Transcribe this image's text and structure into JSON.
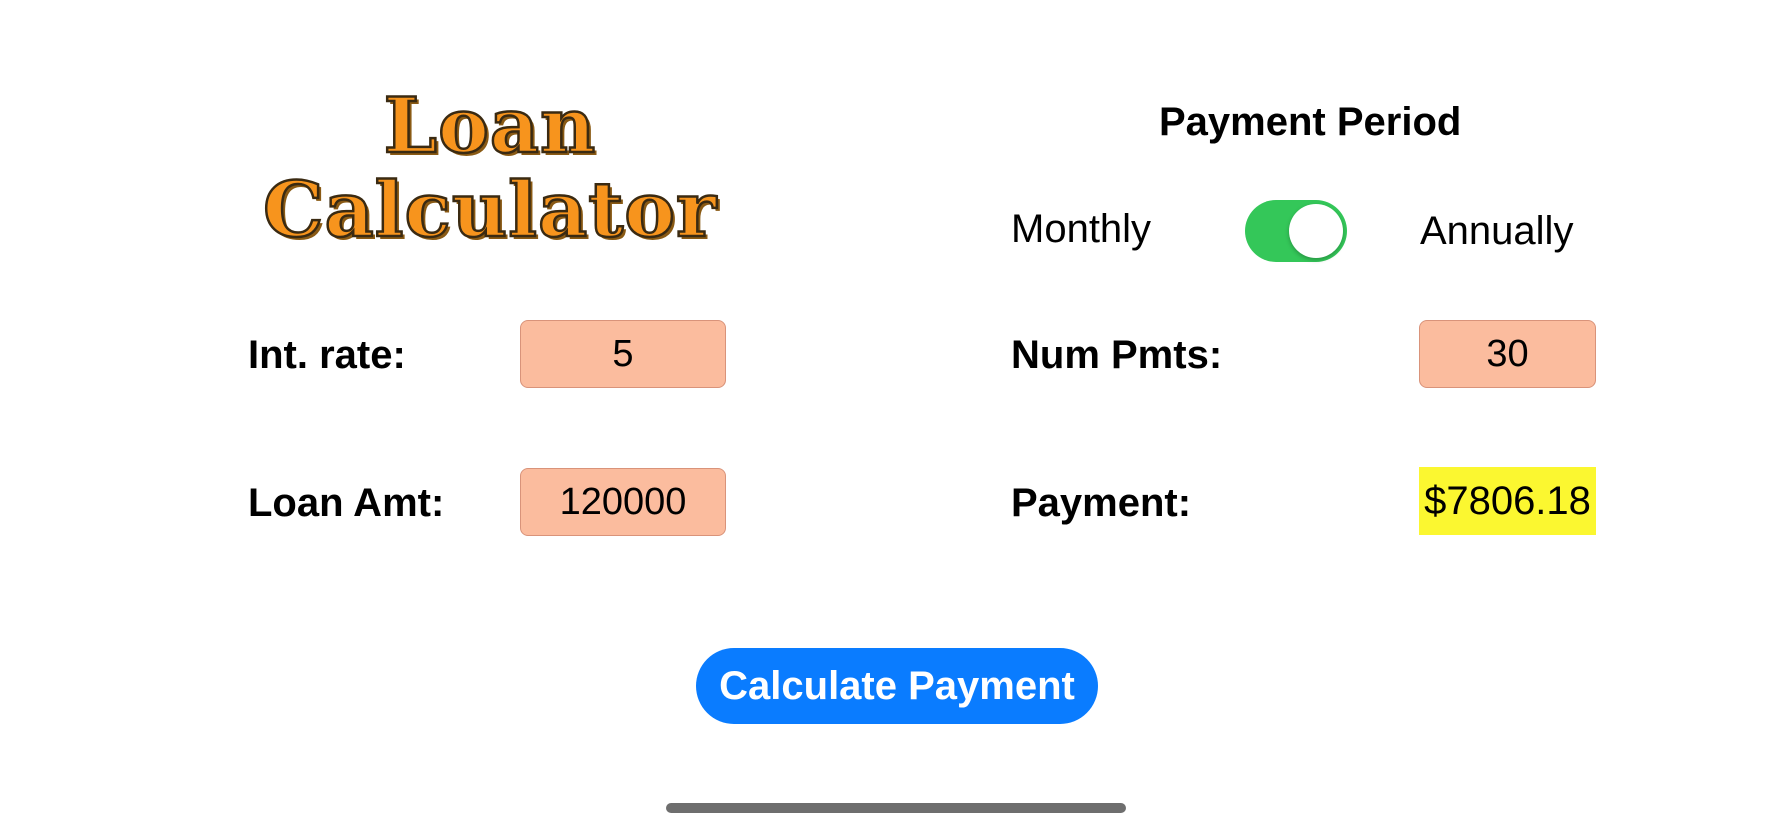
{
  "logo": {
    "line1": "Loan",
    "line2": "Calculator"
  },
  "payment_period": {
    "title": "Payment Period",
    "left_option": "Monthly",
    "right_option": "Annually",
    "toggle_on": true
  },
  "fields": {
    "int_rate": {
      "label": "Int. rate:",
      "value": "5"
    },
    "loan_amt": {
      "label": "Loan Amt:",
      "value": "120000"
    },
    "num_pmts": {
      "label": "Num Pmts:",
      "value": "30"
    },
    "payment": {
      "label": "Payment:",
      "value": "$7806.18"
    }
  },
  "button": {
    "label": "Calculate Payment"
  },
  "colors": {
    "field_bg": "#fbbc9e",
    "result_bg": "#fbf730",
    "toggle_on": "#34c759",
    "button_bg": "#0a7cff",
    "logo_orange": "#f7941d"
  }
}
